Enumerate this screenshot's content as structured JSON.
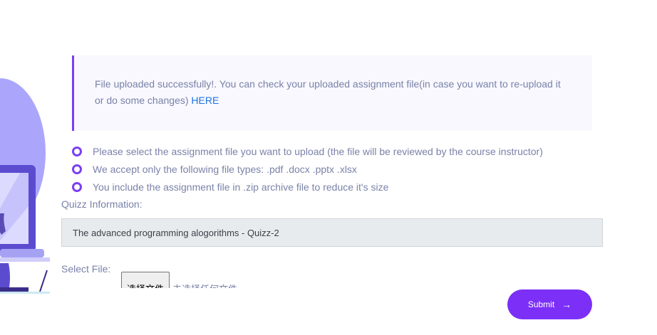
{
  "alert": {
    "message": "File uploaded successfully!. You can check your uploaded assignment file(in case you want to re-upload it or do some changes) ",
    "link_label": "HERE"
  },
  "instructions": [
    "Please select the assignment file you want to upload (the file will be reviewed by the course instructor)",
    "We accept only the following file types: .pdf .docx .pptx .xlsx",
    "You include the assignment file in .zip archive file to reduce it's size"
  ],
  "quiz": {
    "label": "Quizz Information:",
    "value": "The advanced programming alogorithms - Quizz-2"
  },
  "file": {
    "label": "Select File:",
    "button_label": "选择文件",
    "status": "未选择任何文件"
  },
  "submit": {
    "label": "Submit",
    "icon": "arrow-right-icon"
  },
  "colors": {
    "accent": "#7b2ff7",
    "link": "#1b74e4",
    "muted_text": "#7a82a8"
  }
}
